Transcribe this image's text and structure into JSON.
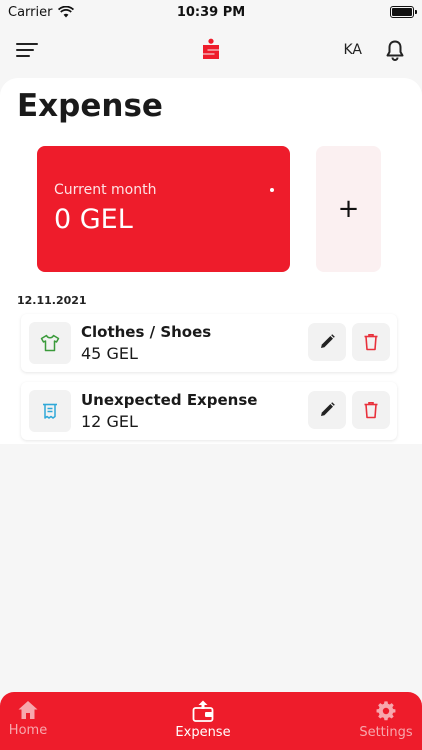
{
  "status_bar": {
    "carrier": "Carrier",
    "time": "10:39 PM"
  },
  "header": {
    "language": "KA"
  },
  "page": {
    "title": "Expense"
  },
  "summary": {
    "label": "Current month",
    "amount": "0 GEL",
    "add_symbol": "+"
  },
  "expenses": {
    "date": "12.11.2021",
    "items": [
      {
        "category": "Clothes / Shoes",
        "amount": "45 GEL",
        "icon": "shirt-icon",
        "icon_color": "#3a9a3a"
      },
      {
        "category": "Unexpected Expense",
        "amount": "12 GEL",
        "icon": "receipt-icon",
        "icon_color": "#2ea8d8"
      }
    ]
  },
  "tabs": [
    {
      "label": "Home",
      "icon": "home-icon",
      "active": false
    },
    {
      "label": "Expense",
      "icon": "wallet-icon",
      "active": true
    },
    {
      "label": "Settings",
      "icon": "gear-icon",
      "active": false
    }
  ],
  "colors": {
    "brand_red": "#ee1c2b",
    "add_card_bg": "#fbf0f1",
    "background": "#f6f6f6"
  }
}
